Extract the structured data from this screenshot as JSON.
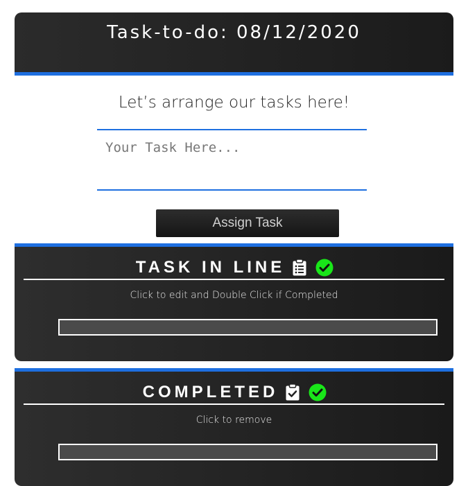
{
  "header": {
    "title": "Task-to-do: 08/12/2020"
  },
  "intro": {
    "subtitle": "Let’s arrange our tasks here!"
  },
  "task_input": {
    "placeholder": "Your Task Here...",
    "value": ""
  },
  "assign_button": {
    "label": "Assign Task"
  },
  "panels": [
    {
      "title": "TASK IN LINE",
      "hint": "Click to edit and Double Click if Completed",
      "icons": [
        "clipboard-list-icon",
        "check-circle-icon"
      ]
    },
    {
      "title": "COMPLETED",
      "hint": "Click to remove",
      "icons": [
        "clipboard-check-icon",
        "check-circle-icon"
      ]
    }
  ],
  "colors": {
    "accent": "#1e6fe0",
    "panel_bg": "#222222",
    "check_green": "#19e619"
  }
}
